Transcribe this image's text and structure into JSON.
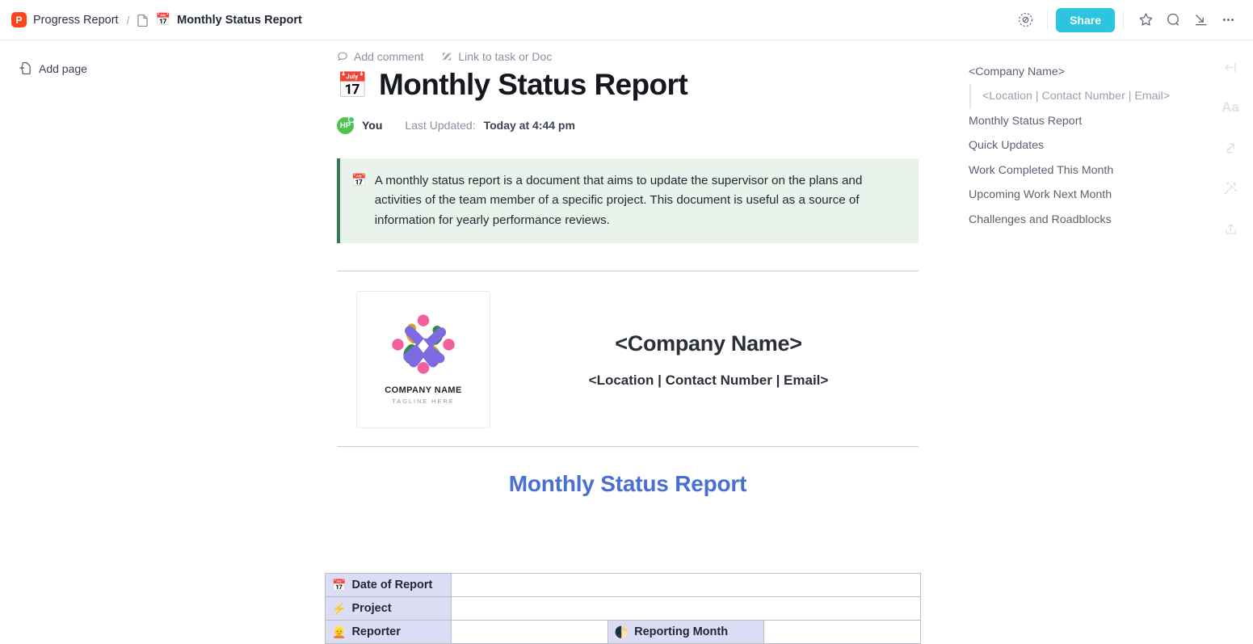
{
  "topbar": {
    "app_badge_letter": "P",
    "breadcrumb_space": "Progress Report",
    "breadcrumb_sep": "/",
    "breadcrumb_doc": "Monthly Status Report",
    "doc_emoji": "📅",
    "page_icon": "📄",
    "share_label": "Share",
    "icons": {
      "privacy": "privacy-eye-icon",
      "star": "star-icon",
      "search": "search-icon",
      "collapse": "collapse-icon",
      "more": "more-options-icon"
    },
    "accent_share": "#2bc5dd",
    "accent_app_badge": "#f9461c"
  },
  "left_rail": {
    "add_page_label": "Add page"
  },
  "doc": {
    "tools": {
      "add_comment": "Add comment",
      "link_to_task": "Link to task or Doc"
    },
    "title": "Monthly Status Report",
    "title_emoji": "📅",
    "meta": {
      "avatar_initials": "HP",
      "author": "You",
      "updated_label": "Last Updated:",
      "updated_value": "Today at 4:44 pm"
    },
    "callout": {
      "emoji": "📅",
      "text": "A monthly status report is a document that aims to update the supervisor on the plans and activities of the team member of a specific project. This document is useful as a source of information for yearly performance reviews.",
      "border_color": "#2e7d52",
      "background": "#e9f3ec"
    },
    "brand": {
      "logo_name": "COMPANY NAME",
      "logo_tagline": "TAGLINE HERE",
      "company_name": "<Company Name>",
      "company_contact": "<Location | Contact Number | Email>"
    },
    "section_heading": "Monthly Status Report",
    "section_heading_color": "#4a6fd4",
    "table": {
      "label_bg": "#dcdcf5",
      "rows": [
        {
          "label_emoji": "📅",
          "label": "Date of Report",
          "value": "",
          "second_label_emoji": "",
          "second_label": "",
          "second_value": ""
        },
        {
          "label_emoji": "⚡",
          "label": "Project",
          "value": "",
          "second_label_emoji": "",
          "second_label": "",
          "second_value": ""
        },
        {
          "label_emoji": "👱",
          "label": "Reporter",
          "value": "",
          "second_label_emoji": "🌓",
          "second_label": "Reporting Month",
          "second_value": ""
        }
      ]
    }
  },
  "outline": {
    "items": [
      {
        "label": "<Company Name>",
        "sub": false
      },
      {
        "label": "<Location | Contact Number | Email>",
        "sub": true
      },
      {
        "label": "Monthly Status Report",
        "sub": false
      },
      {
        "label": "Quick Updates",
        "sub": false
      },
      {
        "label": "Work Completed This Month",
        "sub": false
      },
      {
        "label": "Upcoming Work Next Month",
        "sub": false
      },
      {
        "label": "Challenges and Roadblocks",
        "sub": false
      }
    ]
  },
  "icon_rail": {
    "items": [
      {
        "name": "collapse-panel-icon",
        "glyph": ""
      },
      {
        "name": "text-style-icon",
        "glyph": "Aa"
      },
      {
        "name": "link-icon",
        "glyph": ""
      },
      {
        "name": "magic-wand-icon",
        "glyph": ""
      },
      {
        "name": "upload-share-icon",
        "glyph": ""
      }
    ]
  }
}
